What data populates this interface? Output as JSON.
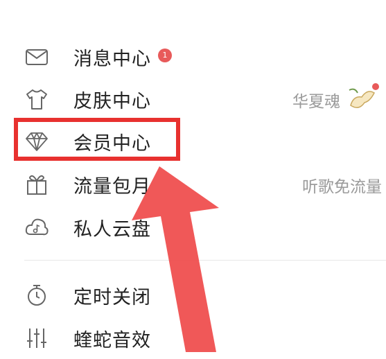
{
  "menu": {
    "messages": {
      "label": "消息中心",
      "badge": "1"
    },
    "skin": {
      "label": "皮肤中心",
      "right_text": "华夏魂"
    },
    "vip": {
      "label": "会员中心"
    },
    "traffic": {
      "label": "流量包月",
      "right_text": "听歌免流量"
    },
    "cloud": {
      "label": "私人云盘"
    },
    "timer": {
      "label": "定时关闭"
    },
    "effects": {
      "label": "蝰蛇音效"
    }
  },
  "colors": {
    "highlight": "#e8312f",
    "arrow": "#ef4f4f",
    "badge": "#e85a5a"
  },
  "icons": [
    "mail-icon",
    "tshirt-icon",
    "diamond-icon",
    "gift-icon",
    "cloud-music-icon",
    "timer-icon",
    "equalizer-icon"
  ]
}
